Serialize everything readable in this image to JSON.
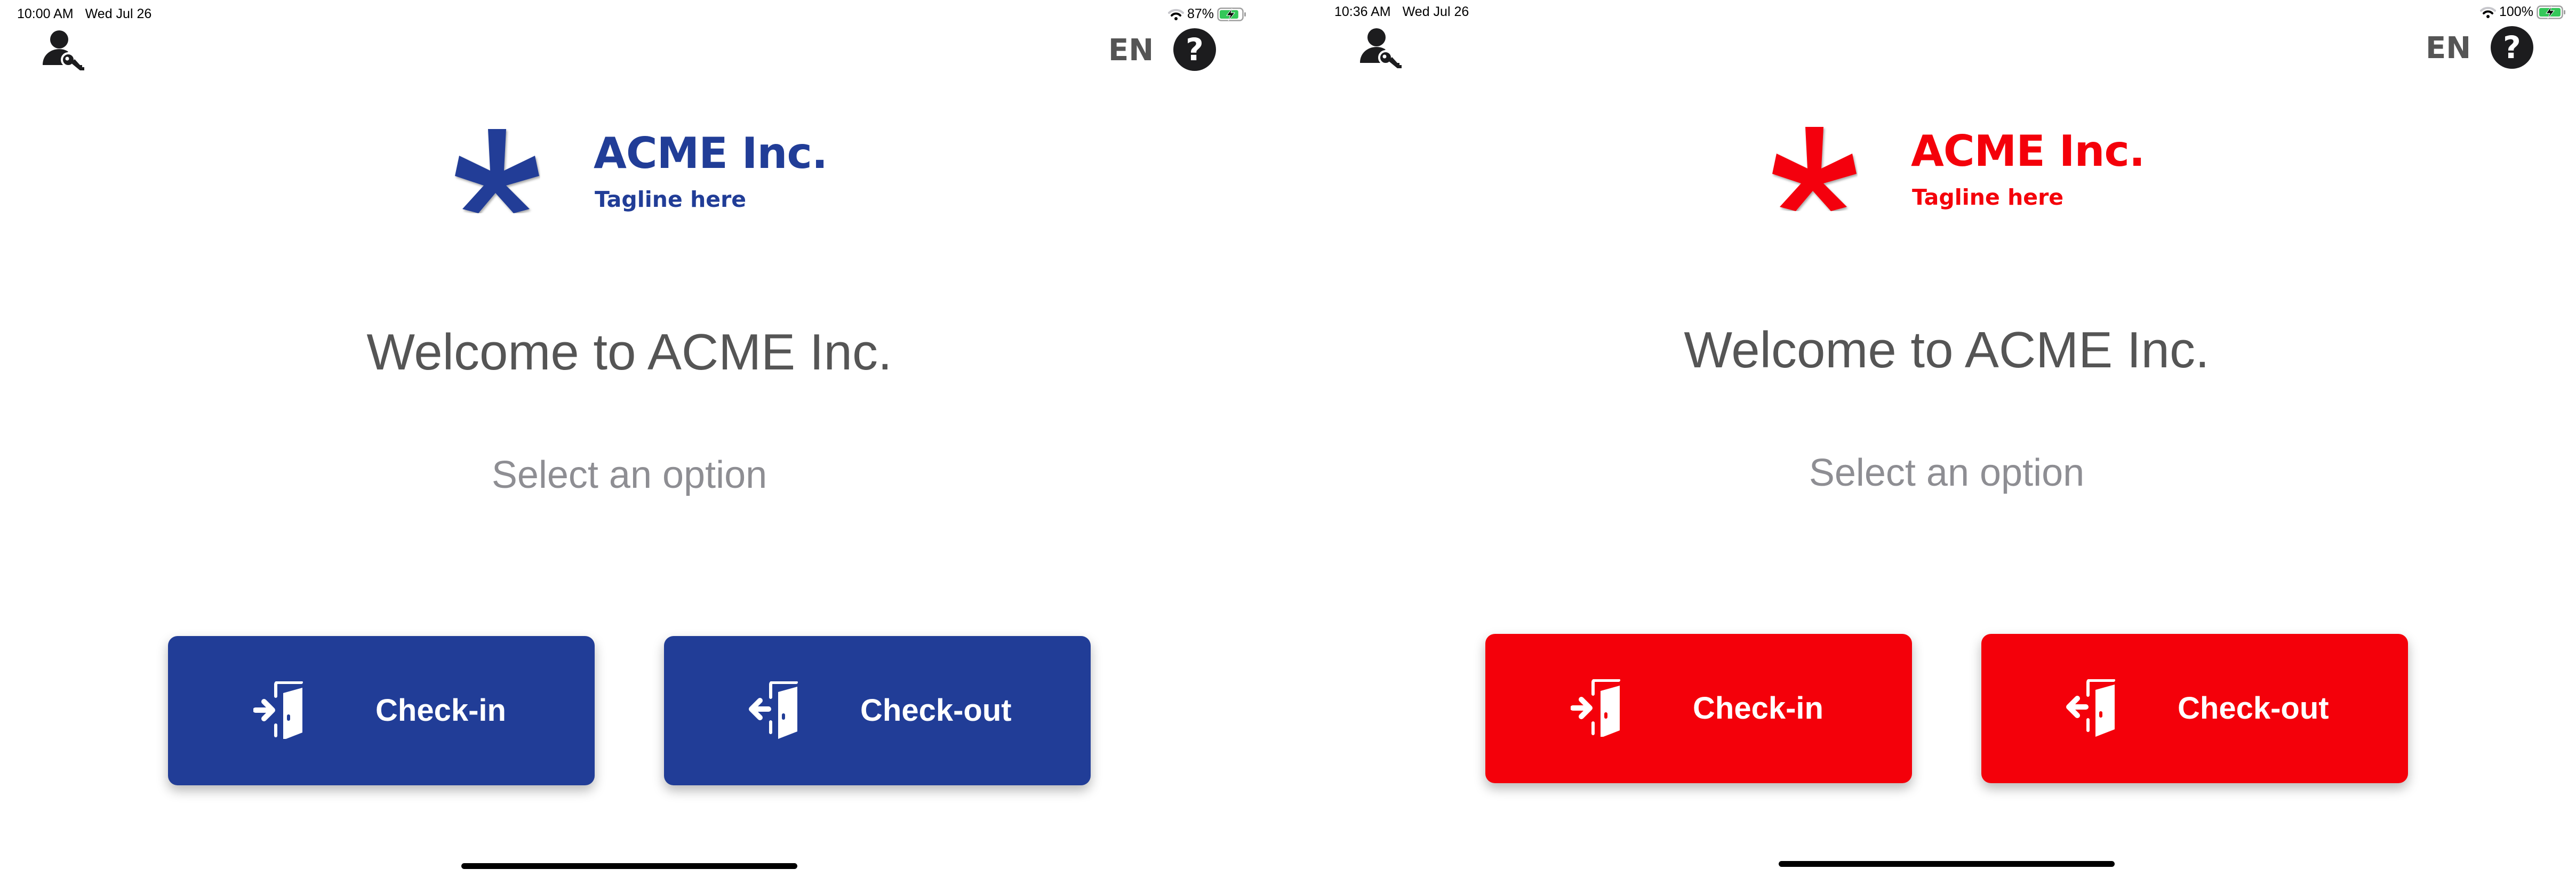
{
  "screens": [
    {
      "status_bar": {
        "time": "10:00 AM",
        "date": "Wed Jul 26",
        "battery_percent": "87%",
        "battery_level": 0.87,
        "charging": true
      },
      "header": {
        "admin_icon": "user-key-icon",
        "language": "EN",
        "help_icon": "question-circle-icon"
      },
      "logo": {
        "symbol": "asterisk-icon",
        "name": "ACME Inc.",
        "tagline": "Tagline here"
      },
      "welcome": "Welcome to ACME Inc.",
      "subtitle": "Select an option",
      "buttons": [
        {
          "label": "Check-in",
          "icon": "door-enter-icon"
        },
        {
          "label": "Check-out",
          "icon": "door-exit-icon"
        }
      ],
      "theme": {
        "brand_color": "#213D97"
      }
    },
    {
      "status_bar": {
        "time": "10:36 AM",
        "date": "Wed Jul 26",
        "battery_percent": "100%",
        "battery_level": 1.0,
        "charging": true
      },
      "header": {
        "admin_icon": "user-key-icon",
        "language": "EN",
        "help_icon": "question-circle-icon"
      },
      "logo": {
        "symbol": "asterisk-icon",
        "name": "ACME Inc.",
        "tagline": "Tagline here"
      },
      "welcome": "Welcome to ACME Inc.",
      "subtitle": "Select an option",
      "buttons": [
        {
          "label": "Check-in",
          "icon": "door-enter-icon"
        },
        {
          "label": "Check-out",
          "icon": "door-exit-icon"
        }
      ],
      "theme": {
        "brand_color": "#F4000A"
      }
    }
  ],
  "colors": {
    "heading_text": "#555555",
    "subtitle_text": "#8E8E93",
    "battery_fill": "#34C759",
    "icon_dark": "#1C1C1E"
  }
}
